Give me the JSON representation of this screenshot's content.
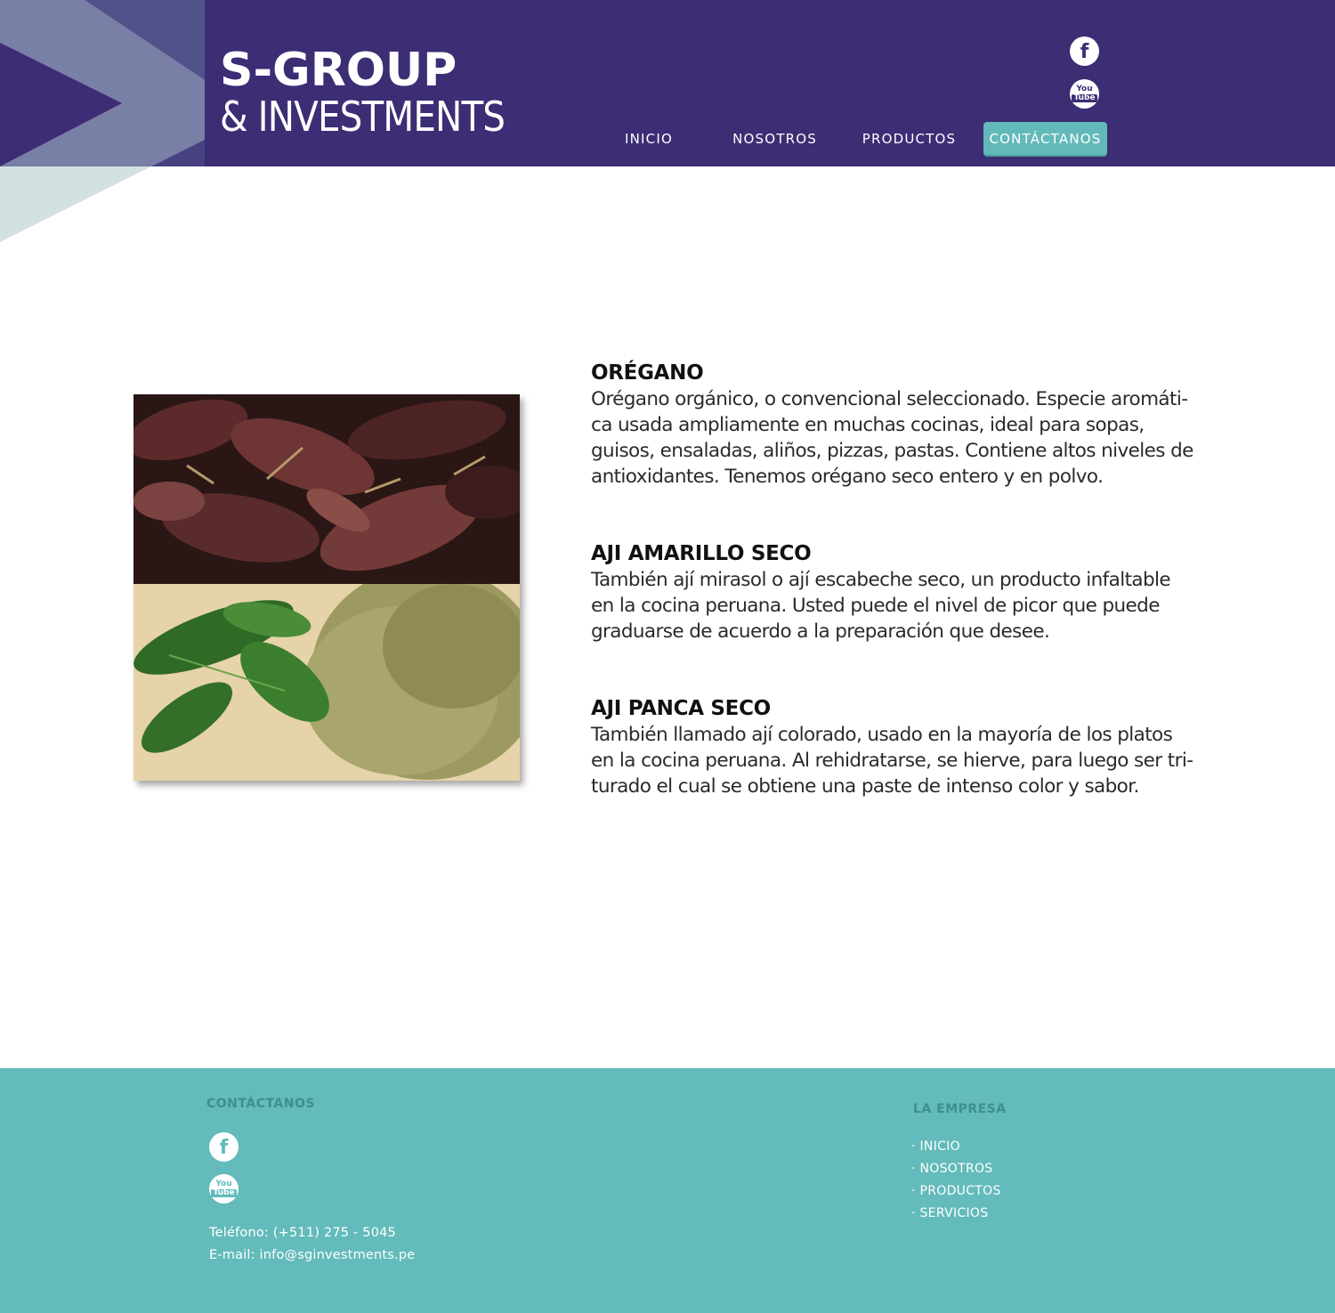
{
  "brand": {
    "line1": "S-GROUP",
    "line2": "& INVESTMENTS"
  },
  "colors": {
    "header_bg": "#3c2d75",
    "accent_teal": "#63b9b9",
    "footer_bg": "#63bbbb",
    "footer_title": "#3f8e91"
  },
  "header": {
    "social": [
      {
        "icon": "facebook-icon",
        "glyph": "f"
      },
      {
        "icon": "youtube-icon",
        "you": "You",
        "tube": "Tube"
      }
    ]
  },
  "nav": {
    "items": [
      {
        "label": "INICIO",
        "active": false
      },
      {
        "label": "NOSOTROS",
        "active": false
      },
      {
        "label": "PRODUCTOS",
        "active": false
      },
      {
        "label": "CONTÁCTANOS",
        "active": true
      }
    ]
  },
  "main": {
    "products": [
      {
        "title": "ORÉGANO",
        "lines": [
          "Orégano orgánico, o convencional seleccionado. Especie aromáti-",
          "ca usada ampliamente en muchas cocinas, ideal para sopas,",
          "guisos, ensaladas, aliños, pizzas, pastas.  Contiene altos niveles de",
          "antioxidantes. Tenemos orégano seco entero y en polvo."
        ]
      },
      {
        "title": "AJI AMARILLO SECO",
        "lines": [
          "También ají mirasol o ají escabeche seco, un producto infaltable",
          "en la cocina peruana. Usted puede el nivel de picor que puede",
          "graduarse de acuerdo a la preparación que desee."
        ]
      },
      {
        "title": "AJI PANCA SECO",
        "lines": [
          "También llamado ají colorado, usado en la mayoría de los platos",
          "en la cocina peruana. Al rehidratarse, se hierve, para luego ser tri-",
          "turado el cual se obtiene una paste de intenso color y sabor."
        ]
      }
    ]
  },
  "footer": {
    "contact_title": "CONTÁCTANOS",
    "social": [
      {
        "icon": "facebook-icon",
        "glyph": "f"
      },
      {
        "icon": "youtube-icon",
        "you": "You",
        "tube": "Tube"
      }
    ],
    "phone": "Teléfono: (+511) 275 - 5045",
    "email": "E-mail: info@sginvestments.pe",
    "empresa_title": "LA EMPRESA",
    "links": [
      "· INICIO",
      "· NOSOTROS",
      "· PRODUCTOS",
      "· SERVICIOS"
    ]
  }
}
